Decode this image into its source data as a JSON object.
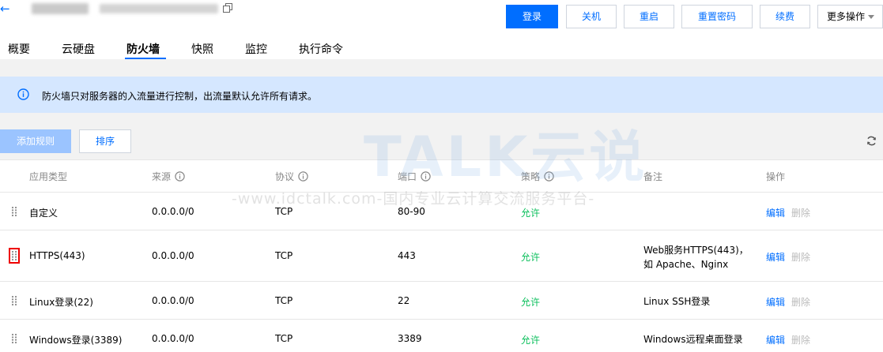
{
  "header": {
    "actions": [
      "登录",
      "关机",
      "重启",
      "重置密码",
      "续费",
      "更多操作"
    ]
  },
  "tabs": [
    "概要",
    "云硬盘",
    "防火墙",
    "快照",
    "监控",
    "执行命令"
  ],
  "notice": "防火墙只对服务器的入流量进行控制，出流量默认允许所有请求。",
  "toolbar": {
    "add": "添加规则",
    "sort": "排序"
  },
  "table": {
    "headers": [
      "应用类型",
      "来源",
      "协议",
      "端口",
      "策略",
      "备注",
      "操作"
    ],
    "rows": [
      {
        "type": "自定义",
        "source": "0.0.0.0/0",
        "protocol": "TCP",
        "port": "80-90",
        "policy": "允许",
        "remark": "",
        "edit": "编辑",
        "delete": "删除"
      },
      {
        "type": "HTTPS(443)",
        "source": "0.0.0.0/0",
        "protocol": "TCP",
        "port": "443",
        "policy": "允许",
        "remark": "Web服务HTTPS(443)，",
        "remark2": "如 Apache、Nginx",
        "edit": "编辑",
        "delete": "删除"
      },
      {
        "type": "Linux登录(22)",
        "source": "0.0.0.0/0",
        "protocol": "TCP",
        "port": "22",
        "policy": "允许",
        "remark": "Linux SSH登录",
        "edit": "编辑",
        "delete": "删除"
      },
      {
        "type": "Windows登录(3389)",
        "source": "0.0.0.0/0",
        "protocol": "TCP",
        "port": "3389",
        "policy": "允许",
        "remark": "Windows远程桌面登录",
        "edit": "编辑",
        "delete": "删除"
      }
    ]
  },
  "watermark": {
    "logo": "TALK云说",
    "url": "-www.idctalk.com-国内专业云计算交流服务平台-"
  },
  "colors": {
    "primary": "#006eff",
    "allow": "#0abf5b",
    "notice_bg": "#d5e7ff"
  }
}
